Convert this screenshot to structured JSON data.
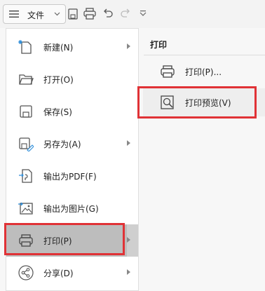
{
  "toolbar": {
    "file_label": "文件",
    "icons": [
      "menu-icon",
      "chevron-down-icon",
      "save-icon",
      "print-icon",
      "undo-icon",
      "redo-icon",
      "customize-icon"
    ]
  },
  "file_menu": {
    "items": [
      {
        "label": "新建(N)",
        "icon": "new-file-icon",
        "has_submenu": true
      },
      {
        "label": "打开(O)",
        "icon": "folder-icon",
        "has_submenu": false
      },
      {
        "label": "保存(S)",
        "icon": "save-icon",
        "has_submenu": false
      },
      {
        "label": "另存为(A)",
        "icon": "save-as-icon",
        "has_submenu": true
      },
      {
        "label": "输出为PDF(F)",
        "icon": "export-pdf-icon",
        "has_submenu": false
      },
      {
        "label": "输出为图片(G)",
        "icon": "export-image-icon",
        "has_submenu": false
      },
      {
        "label": "打印(P)",
        "icon": "printer-icon",
        "has_submenu": true,
        "selected": true
      },
      {
        "label": "分享(D)",
        "icon": "share-icon",
        "has_submenu": true
      }
    ]
  },
  "print_submenu": {
    "title": "打印",
    "items": [
      {
        "label": "打印(P)...",
        "icon": "printer-icon"
      },
      {
        "label": "打印预览(V)",
        "icon": "print-preview-icon",
        "highlighted": true
      }
    ]
  },
  "colors": {
    "highlight_border": "#e03236",
    "selected_bg": "#bdbdbd",
    "panel_bg": "#ffffff",
    "toolbar_bg": "#f3f3f3"
  }
}
